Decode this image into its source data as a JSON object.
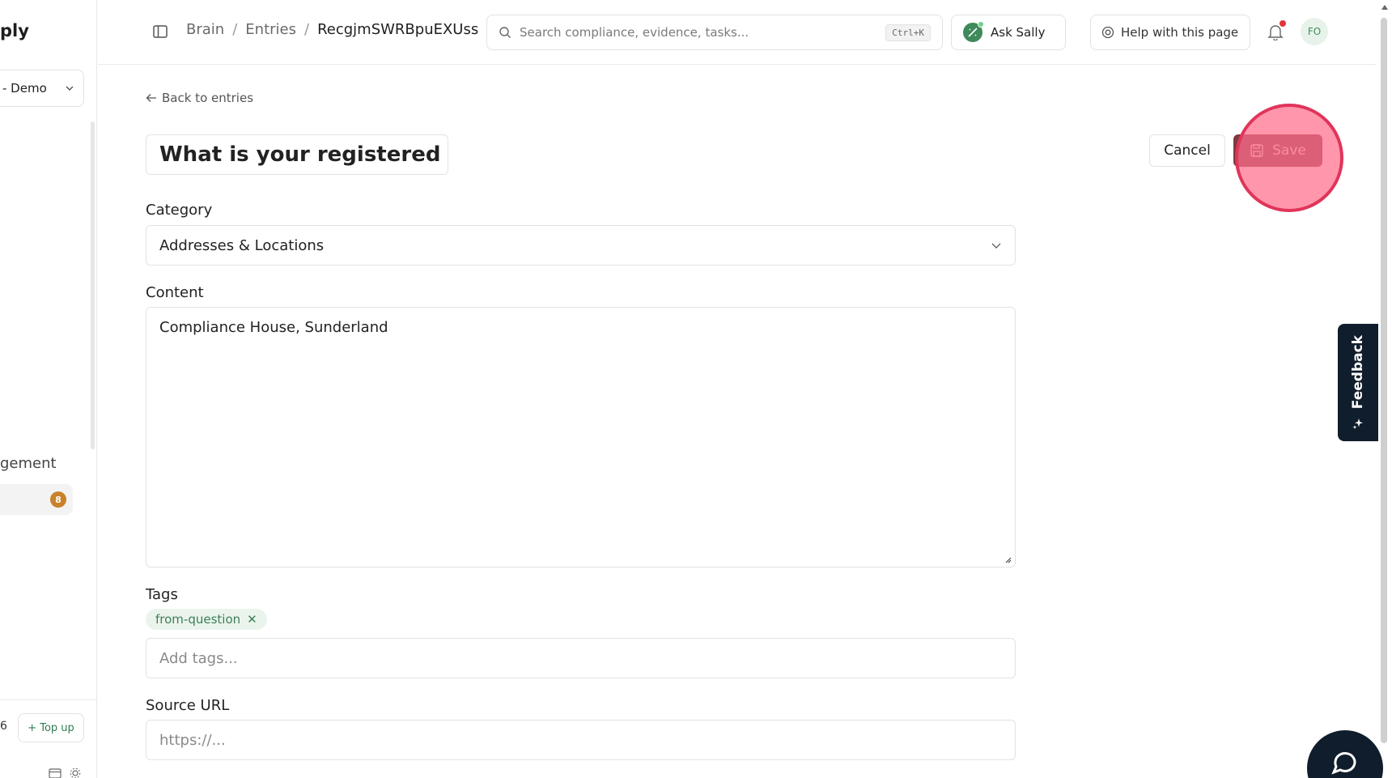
{
  "sidebar": {
    "brand_fragment": "ply",
    "org_select": "- Demo",
    "section_fragment": "gement",
    "badge_count": "8",
    "credits_fragment": "6",
    "topup_label": "+ Top up"
  },
  "header": {
    "breadcrumb": [
      {
        "label": "Brain"
      },
      {
        "label": "Entries"
      }
    ],
    "breadcrumb_sep": "/",
    "breadcrumb_current": "RecgjmSWRBpuEXUss",
    "search_placeholder": "Search compliance, evidence, tasks...",
    "search_shortcut": "Ctrl+K",
    "ask_label": "Ask Sally",
    "help_label": "Help with this page",
    "user_initials": "FO"
  },
  "main": {
    "back_label": "Back to entries",
    "title_value": "What is your registered offi",
    "cancel_label": "Cancel",
    "save_label": "Save",
    "category_label": "Category",
    "category_value": "Addresses & Locations",
    "content_label": "Content",
    "content_value": "Compliance House, Sunderland",
    "tags_label": "Tags",
    "tags": [
      "from-question"
    ],
    "tags_placeholder": "Add tags...",
    "source_label": "Source URL",
    "source_placeholder": "https://..."
  },
  "feedback_label": "Feedback",
  "colors": {
    "accent_green": "#3f8a5a",
    "save_button": "#7d3b3f",
    "click_highlight": "#e0355a",
    "feedback_bg": "#101d2c",
    "badge_orange": "#c9822b"
  }
}
